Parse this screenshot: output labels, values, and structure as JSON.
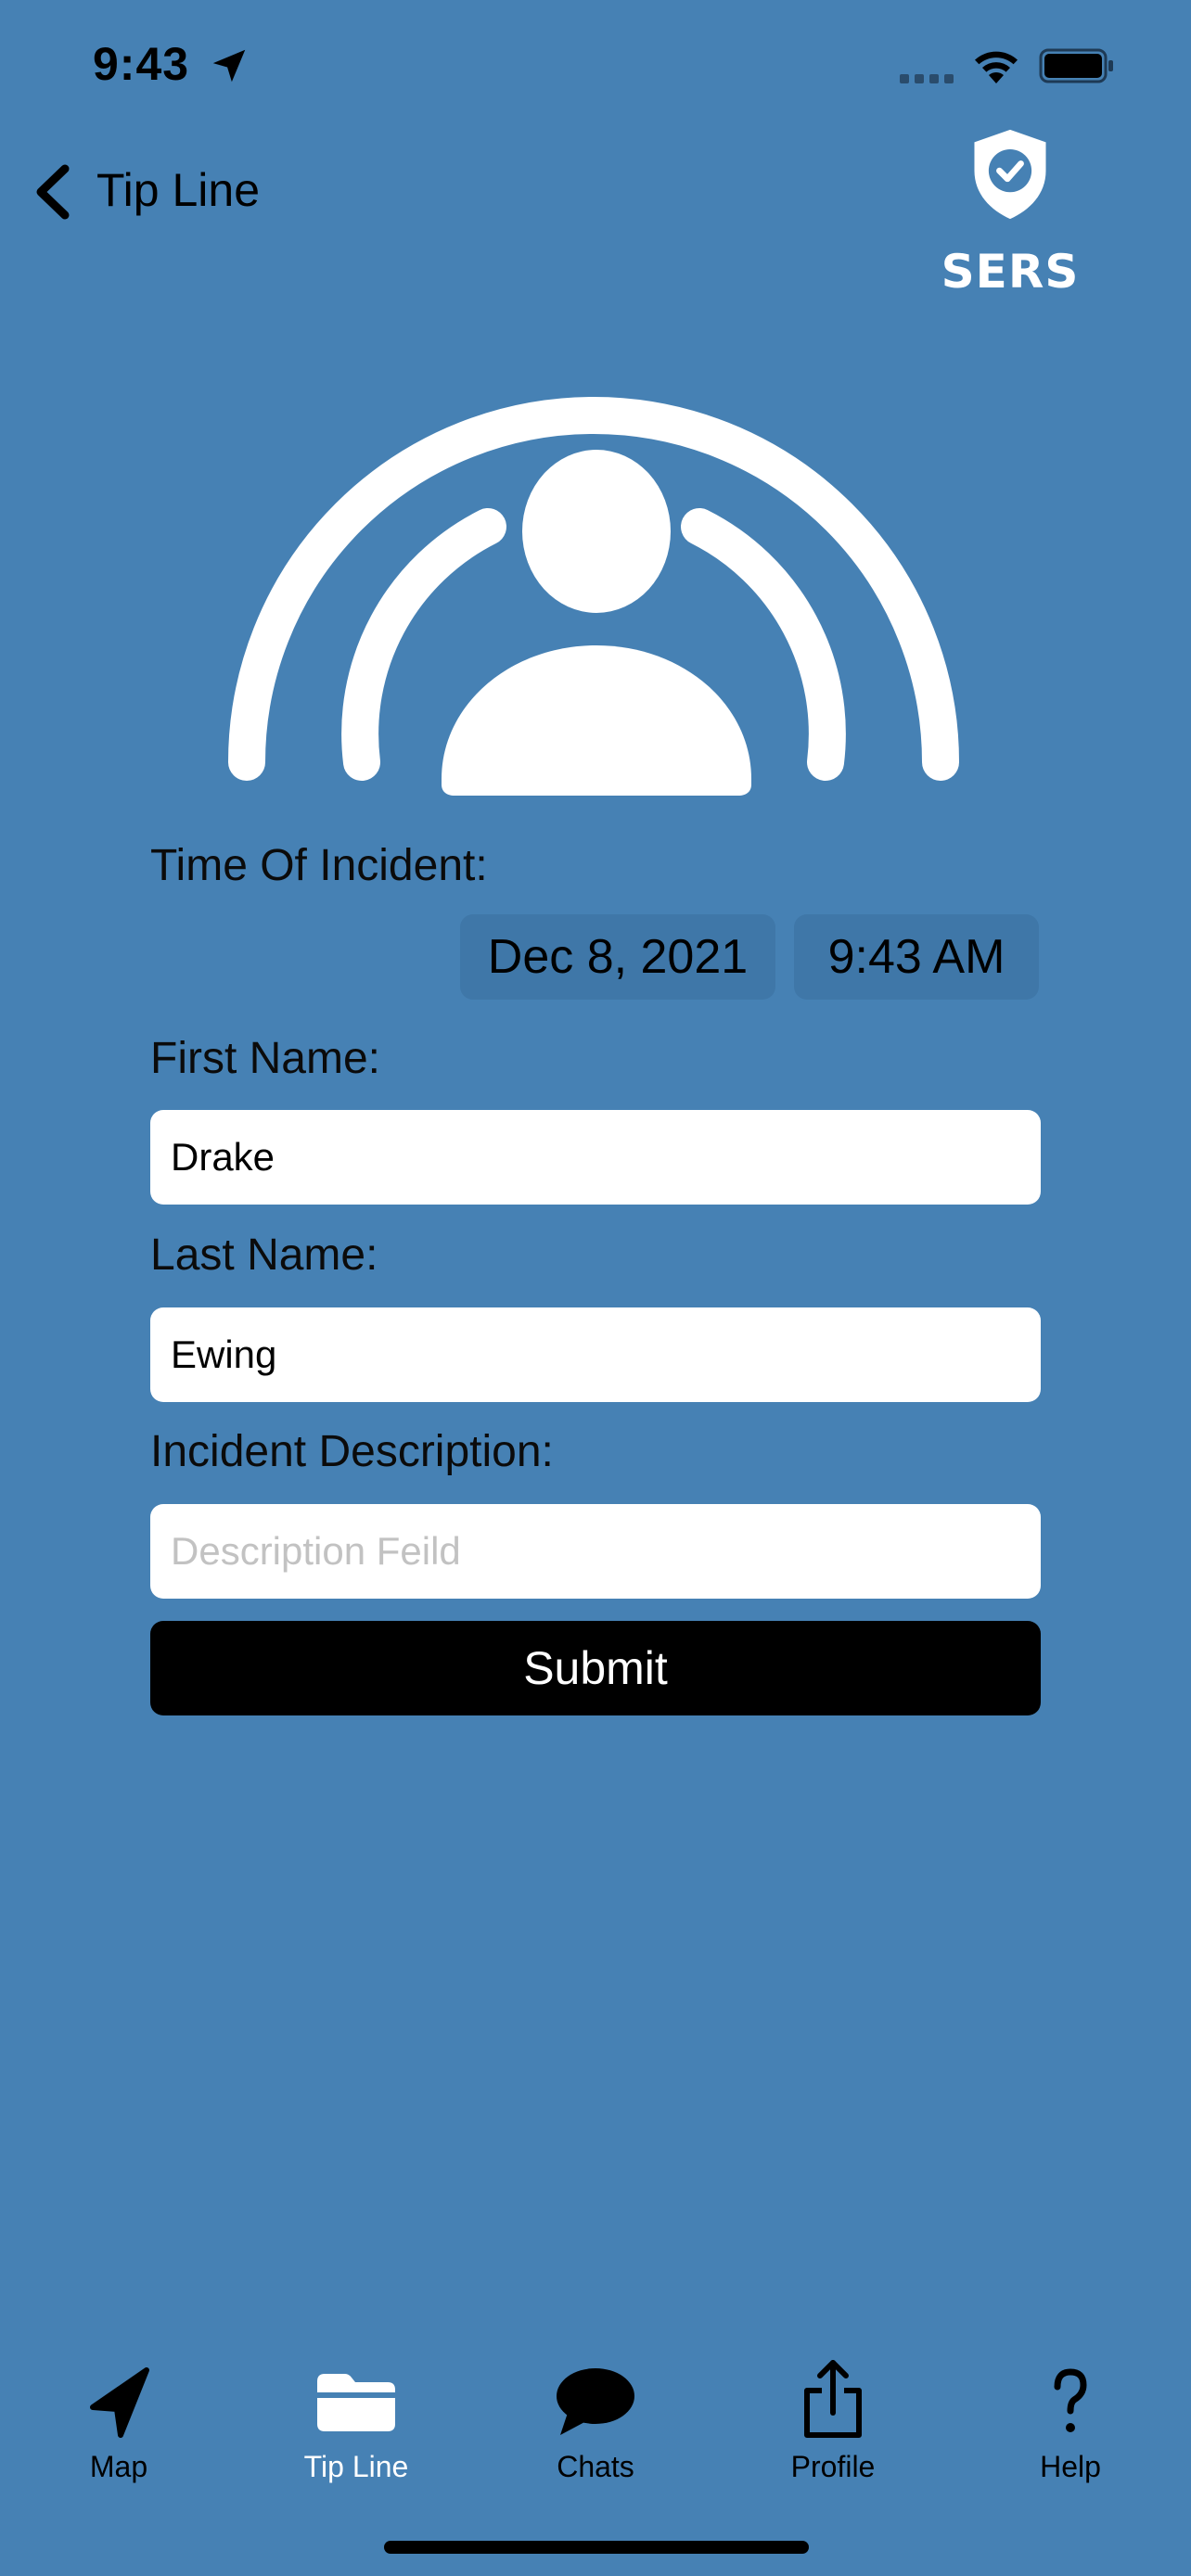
{
  "status_bar": {
    "time": "9:43"
  },
  "nav": {
    "back_label": "Tip Line"
  },
  "logo": {
    "text": "SERS"
  },
  "form": {
    "time_label": "Time Of Incident:",
    "date_value": "Dec 8, 2021",
    "time_value": "9:43 AM",
    "first_name_label": "First Name:",
    "first_name_value": "Drake",
    "last_name_label": "Last Name:",
    "last_name_value": "Ewing",
    "description_label": "Incident Description:",
    "description_placeholder": "Description Feild",
    "submit_label": "Submit"
  },
  "tabs": [
    {
      "label": "Map",
      "icon": "location-arrow-icon",
      "active": false
    },
    {
      "label": "Tip Line",
      "icon": "folder-icon",
      "active": true
    },
    {
      "label": "Chats",
      "icon": "chat-bubble-icon",
      "active": false
    },
    {
      "label": "Profile",
      "icon": "share-icon",
      "active": false
    },
    {
      "label": "Help",
      "icon": "question-mark-icon",
      "active": false
    }
  ],
  "colors": {
    "background": "#4681b4",
    "accent": "#ffffff",
    "button": "#000000"
  }
}
